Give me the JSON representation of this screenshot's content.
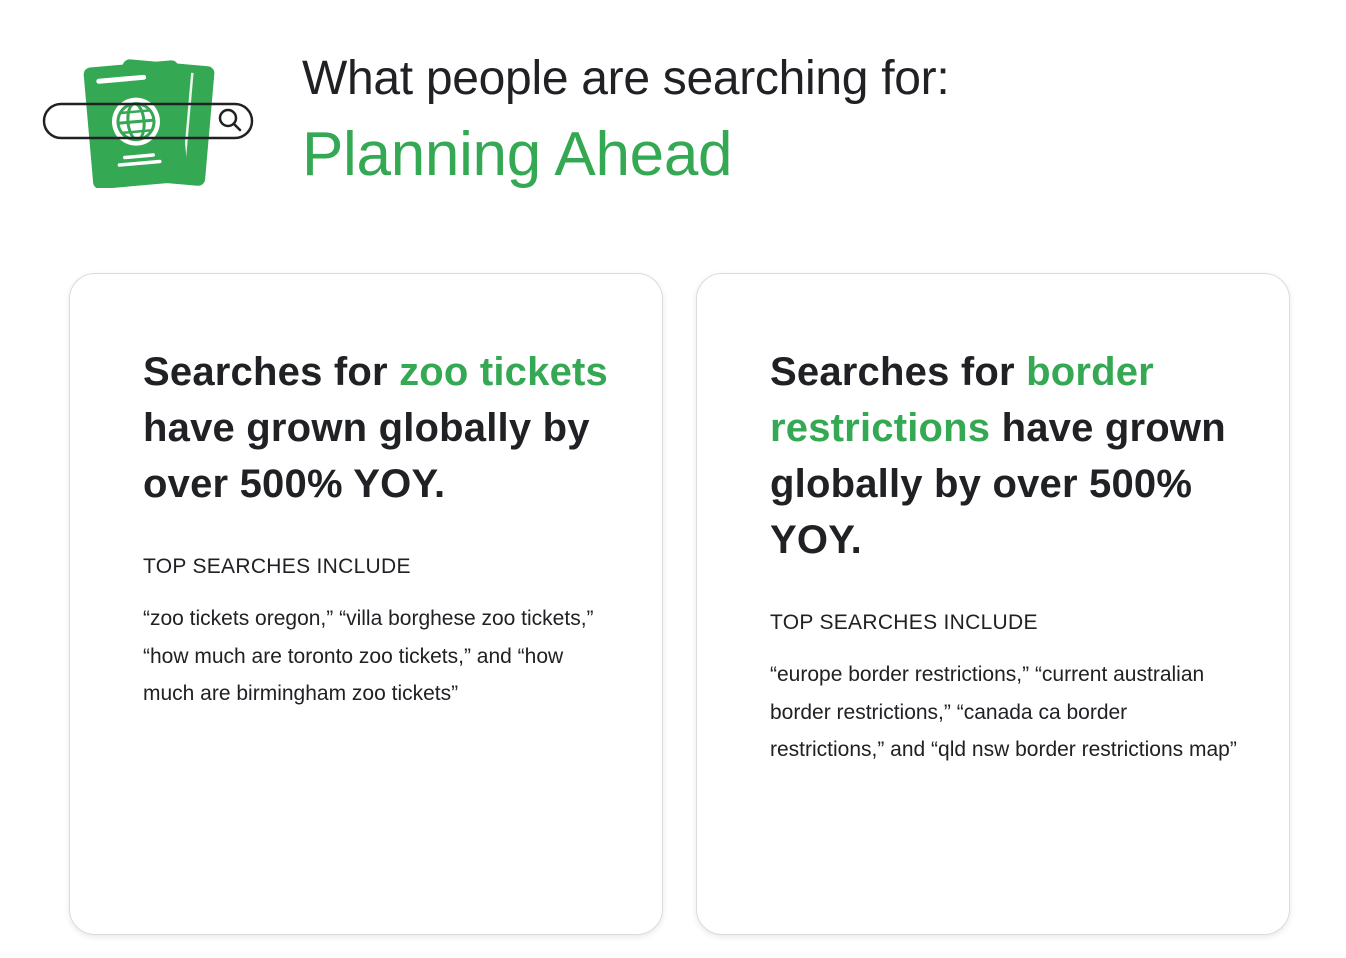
{
  "header": {
    "kicker": "What people are searching for:",
    "title": "Planning Ahead",
    "icon": "passport-search-icon"
  },
  "colors": {
    "accent": "#34a853",
    "text": "#202124",
    "card_border": "#dadce0"
  },
  "cards": [
    {
      "headline_before": "Searches for ",
      "headline_highlight": "zoo tickets",
      "headline_after": " have grown globally by over 500% YOY.",
      "subheading": "TOP SEARCHES INCLUDE",
      "body": "“zoo tickets oregon,” “villa borghese zoo tickets,” “how much are toronto zoo tickets,” and “how much are birmingham zoo tickets”"
    },
    {
      "headline_before": "Searches for ",
      "headline_highlight": "border restrictions",
      "headline_after": " have grown globally by over 500% YOY.",
      "subheading": "TOP SEARCHES INCLUDE",
      "body": "“europe border restrictions,” “current australian border restrictions,” “canada ca border restrictions,” and “qld nsw border restrictions map”"
    }
  ]
}
